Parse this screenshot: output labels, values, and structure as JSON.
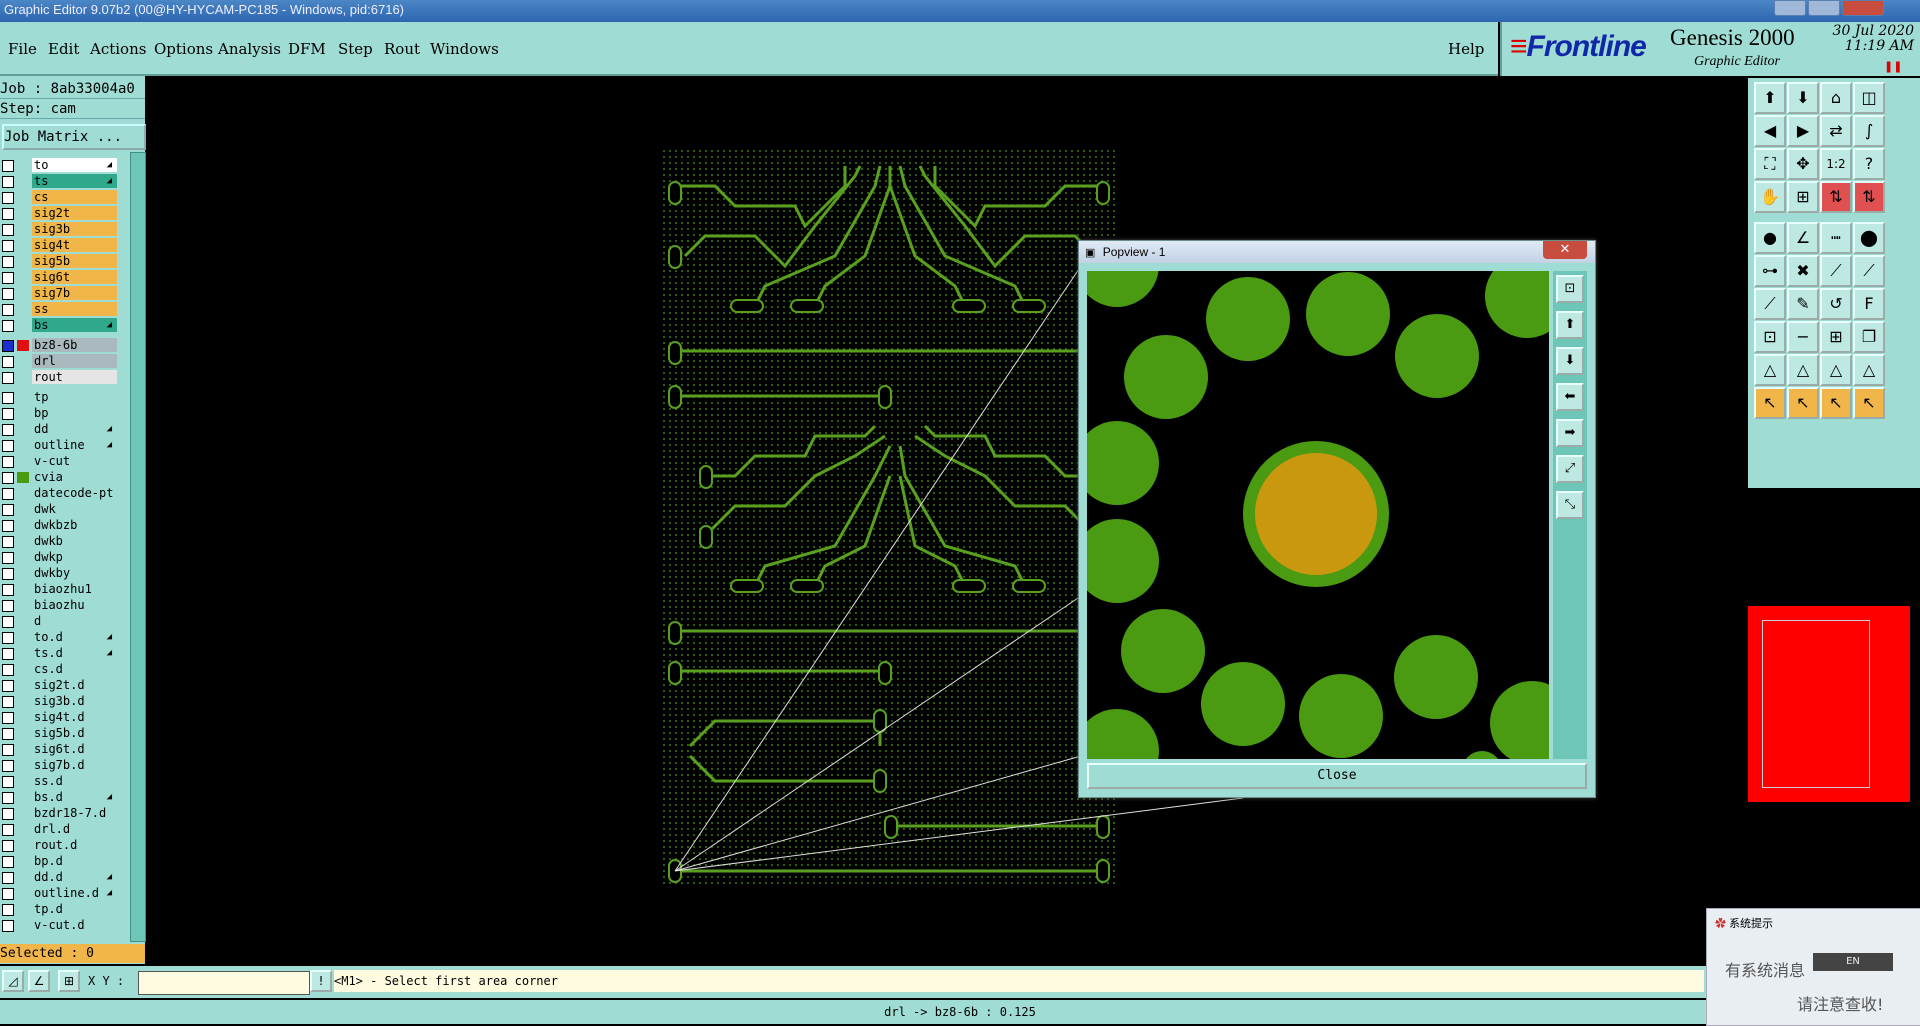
{
  "window": {
    "title": "Graphic Editor 9.07b2 (00@HY-HYCAM-PC185 - Windows, pid:6716)"
  },
  "menu": [
    "File",
    "Edit",
    "Actions",
    "Options",
    "Analysis",
    "DFM",
    "Step",
    "Rout",
    "Windows"
  ],
  "help_label": "Help",
  "brand": {
    "logo": "Frontline",
    "product": "Genesis 2000",
    "subtitle": "Graphic Editor",
    "date": "30 Jul 2020",
    "time": "11:19 AM"
  },
  "job": {
    "job_label": "Job : 8ab33004a0",
    "step_label": "Step: cam",
    "matrix_button": "Job Matrix ..."
  },
  "layers": [
    {
      "name": "to",
      "bg": "#ffffff",
      "arrow": true
    },
    {
      "name": "ts",
      "bg": "#2fa88c",
      "arrow": true
    },
    {
      "name": "cs",
      "bg": "#f0b64a"
    },
    {
      "name": "sig2t",
      "bg": "#f0b64a"
    },
    {
      "name": "sig3b",
      "bg": "#f0b64a"
    },
    {
      "name": "sig4t",
      "bg": "#f0b64a"
    },
    {
      "name": "sig5b",
      "bg": "#f0b64a"
    },
    {
      "name": "sig6t",
      "bg": "#f0b64a"
    },
    {
      "name": "sig7b",
      "bg": "#f0b64a"
    },
    {
      "name": "ss",
      "bg": "#f0b64a"
    },
    {
      "name": "bs",
      "bg": "#2fa88c",
      "arrow": true
    },
    {
      "name": "bz8-6b",
      "bg": "#a9b9bd",
      "sep": true,
      "active": true
    },
    {
      "name": "drl",
      "bg": "#a9b9bd"
    },
    {
      "name": "rout",
      "bg": "#e5e5e5"
    },
    {
      "name": "tp",
      "bg": "#9fdcd3",
      "sep": true
    },
    {
      "name": "bp",
      "bg": "#9fdcd3"
    },
    {
      "name": "dd",
      "bg": "#9fdcd3",
      "arrow": true
    },
    {
      "name": "outline",
      "bg": "#9fdcd3",
      "arrow": true
    },
    {
      "name": "v-cut",
      "bg": "#9fdcd3"
    },
    {
      "name": "cvia",
      "bg": "#9fdcd3",
      "green": true
    },
    {
      "name": "datecode-pt",
      "bg": "#9fdcd3"
    },
    {
      "name": "dwk",
      "bg": "#9fdcd3"
    },
    {
      "name": "dwkbzb",
      "bg": "#9fdcd3"
    },
    {
      "name": "dwkb",
      "bg": "#9fdcd3"
    },
    {
      "name": "dwkp",
      "bg": "#9fdcd3"
    },
    {
      "name": "dwkby",
      "bg": "#9fdcd3"
    },
    {
      "name": "biaozhu1",
      "bg": "#9fdcd3"
    },
    {
      "name": "biaozhu",
      "bg": "#9fdcd3"
    },
    {
      "name": "d",
      "bg": "#9fdcd3"
    },
    {
      "name": "to.d",
      "bg": "#9fdcd3",
      "arrow": true
    },
    {
      "name": "ts.d",
      "bg": "#9fdcd3",
      "arrow": true
    },
    {
      "name": "cs.d",
      "bg": "#9fdcd3"
    },
    {
      "name": "sig2t.d",
      "bg": "#9fdcd3"
    },
    {
      "name": "sig3b.d",
      "bg": "#9fdcd3"
    },
    {
      "name": "sig4t.d",
      "bg": "#9fdcd3"
    },
    {
      "name": "sig5b.d",
      "bg": "#9fdcd3"
    },
    {
      "name": "sig6t.d",
      "bg": "#9fdcd3"
    },
    {
      "name": "sig7b.d",
      "bg": "#9fdcd3"
    },
    {
      "name": "ss.d",
      "bg": "#9fdcd3"
    },
    {
      "name": "bs.d",
      "bg": "#9fdcd3",
      "arrow": true
    },
    {
      "name": "bzdr18-7.d",
      "bg": "#9fdcd3"
    },
    {
      "name": "drl.d",
      "bg": "#9fdcd3"
    },
    {
      "name": "rout.d",
      "bg": "#9fdcd3"
    },
    {
      "name": "bp.d",
      "bg": "#9fdcd3"
    },
    {
      "name": "dd.d",
      "bg": "#9fdcd3",
      "arrow": true
    },
    {
      "name": "outline.d",
      "bg": "#9fdcd3",
      "arrow": true
    },
    {
      "name": "tp.d",
      "bg": "#9fdcd3"
    },
    {
      "name": "v-cut.d",
      "bg": "#9fdcd3"
    }
  ],
  "selected_label": "Selected : 0",
  "xy_label": "X Y :",
  "xy_value": "",
  "command_prompt": "<M1> - Select first area corner",
  "status_text": "drl -> bz8-6b : 0.125",
  "popview": {
    "title": "Popview - 1",
    "close_label": "Close"
  },
  "notification": {
    "title": "系统提示",
    "line1": "有系统消息",
    "line2": "请注意查收!",
    "ime": "EN"
  },
  "colors": {
    "panel": "#9fdcd3",
    "pcb_green": "#4a9a12",
    "pad_orange": "#c9980e"
  }
}
